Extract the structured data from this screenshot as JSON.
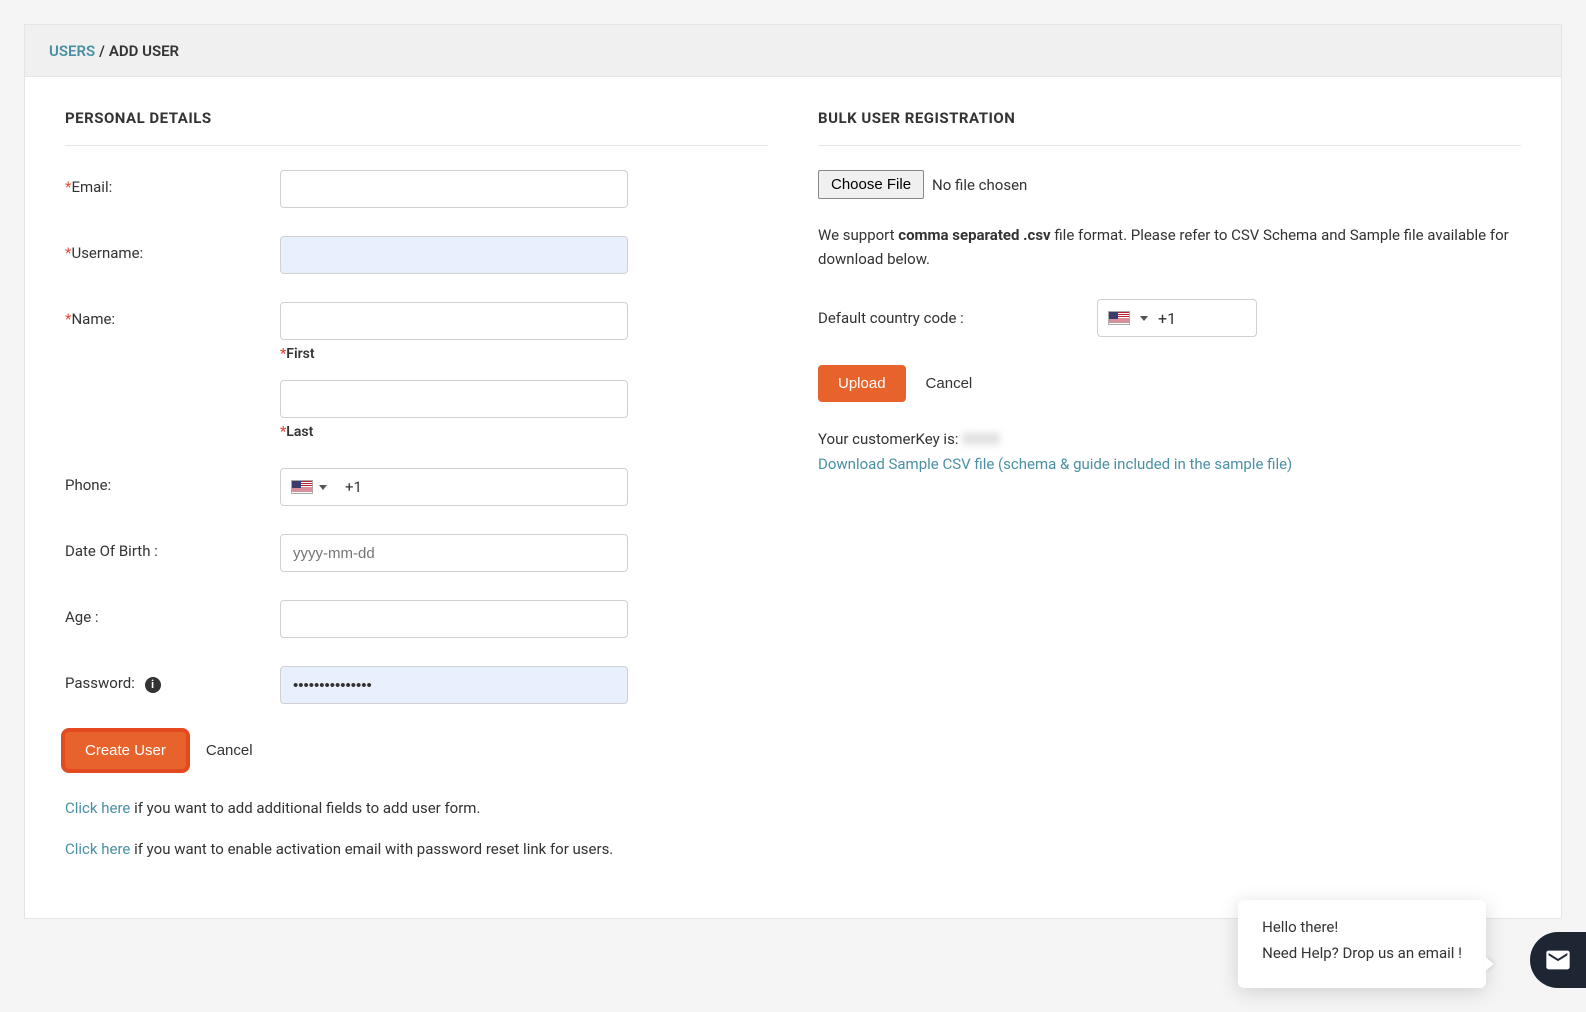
{
  "breadcrumb": {
    "root": "USERS",
    "sep": "/",
    "current": "ADD USER"
  },
  "personal": {
    "title": "PERSONAL DETAILS",
    "email_label": "Email:",
    "username_label": "Username:",
    "username_value": "",
    "name_label": "Name:",
    "first_label": "First",
    "last_label": "Last",
    "phone_label": "Phone:",
    "phone_code": "+1",
    "dob_label": "Date Of Birth :",
    "dob_placeholder": "yyyy-mm-dd",
    "age_label": "Age :",
    "password_label": "Password:",
    "password_value": "•••••••••••••••",
    "create_btn": "Create User",
    "cancel_btn": "Cancel",
    "help1_link": "Click here",
    "help1_text": " if you want to add additional fields to add user form.",
    "help2_link": "Click here",
    "help2_text": " if you want to enable activation email with password reset link for users."
  },
  "bulk": {
    "title": "BULK USER REGISTRATION",
    "choose_file": "Choose File",
    "no_file": "No file chosen",
    "support_pre": "We support ",
    "support_bold": "comma separated .csv",
    "support_post": " file format. Please refer to CSV Schema and Sample file available for download below.",
    "cc_label": "Default country code :",
    "cc_value": "+1",
    "upload_btn": "Upload",
    "cancel_btn": "Cancel",
    "ck_label": "Your customerKey is:",
    "ck_value": "XXXX",
    "download_link": "Download Sample CSV file (schema & guide included in the sample file)"
  },
  "chat": {
    "line1": "Hello there!",
    "line2": "Need Help? Drop us an email !"
  }
}
